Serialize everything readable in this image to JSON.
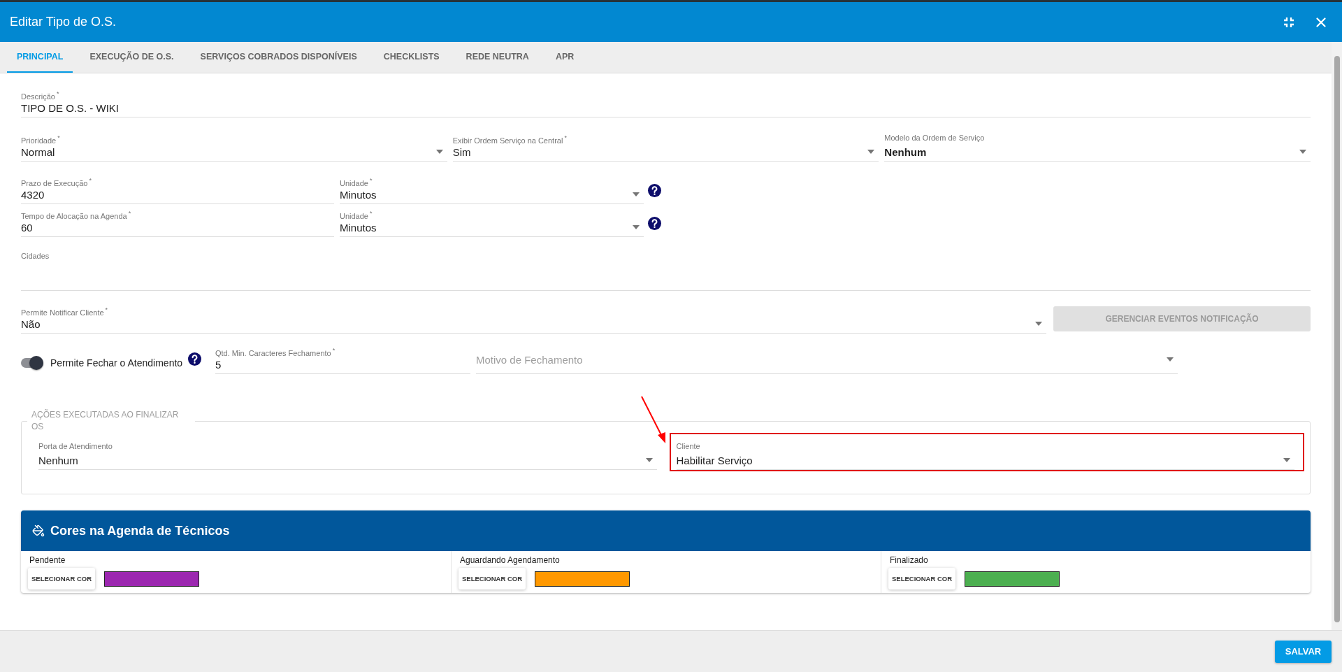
{
  "window": {
    "title": "Editar Tipo de O.S."
  },
  "tabs": [
    {
      "label": "PRINCIPAL",
      "selected": true
    },
    {
      "label": "EXECUÇÃO DE O.S.",
      "selected": false
    },
    {
      "label": "SERVIÇOS COBRADOS DISPONÍVEIS",
      "selected": false
    },
    {
      "label": "CHECKLISTS",
      "selected": false
    },
    {
      "label": "REDE NEUTRA",
      "selected": false
    },
    {
      "label": "APR",
      "selected": false
    }
  ],
  "rows": [
    {
      "items": [
        {
          "kind": "text",
          "label": "Descrição$^{*}$",
          "value": "TIPO DE O.S. - WIKI"
        }
      ]
    },
    {
      "items": [
        {
          "kind": "select",
          "label": "Prioridade$^{*}$",
          "value": "Normal"
        },
        {
          "kind": "select",
          "label": "Exibir Ordem Serviço na Central$^{*}$",
          "value": "Sim"
        },
        {
          "kind": "select",
          "label": "Modelo da Ordem de Serviço",
          "value": "Nenhum",
          "emphasized": true
        }
      ]
    },
    {
      "items": [
        {
          "kind": "text",
          "label": "Prazo de Execução$^{*}$",
          "value": "4320"
        },
        {
          "kind": "select",
          "label": "Unidade$^{*}$",
          "value": "Minutos",
          "help": true
        }
      ]
    },
    {
      "items": [
        {
          "kind": "text",
          "label": "Tempo de Alocação na Agenda$^{*}$",
          "value": "60"
        },
        {
          "kind": "select",
          "label": "Unidade$^{*}$",
          "value": "Minutos",
          "help": true
        }
      ]
    },
    {
      "items": [
        {
          "kind": "area",
          "label": "Cidades"
        }
      ]
    },
    {
      "items": [
        {
          "kind": "select",
          "label": "Permite Notificar Cliente$^{*}$",
          "value": "Não"
        },
        {
          "kind": "button",
          "label": "GERENCIAR EVENTOS NOTIFICAÇÃO",
          "disabled": true
        }
      ]
    },
    {
      "items": [
        {
          "kind": "toggle",
          "label": "Permite Fechar o Atendimento",
          "on": true,
          "help": true
        },
        {
          "kind": "text",
          "label": "Qtd. Min. Caracteres Fechamento$^{*}$",
          "value": "5"
        },
        {
          "kind": "select",
          "placeholder": "Motivo de Fechamento"
        }
      ]
    }
  ],
  "fieldset": {
    "legend": "AÇÕES EXECUTADAS AO FINALIZAR OS",
    "items": [
      {
        "kind": "select",
        "label": "Porta de Atendimento",
        "value": "Nenhum",
        "highlighted": false
      },
      {
        "kind": "select",
        "label": "Cliente",
        "value": "Habilitar Serviço",
        "highlighted": true
      }
    ]
  },
  "colors": {
    "title": "Cores na Agenda de Técnicos",
    "items": [
      {
        "label": "Pendente",
        "button": "SELECIONAR COR",
        "color": "#9c27b0"
      },
      {
        "label": "Aguardando Agendamento",
        "button": "SELECIONAR COR",
        "color": "#ff9800"
      },
      {
        "label": "Finalizado",
        "button": "SELECIONAR COR",
        "color": "#4caf50"
      }
    ]
  },
  "footer": {
    "save": "SALVAR"
  }
}
